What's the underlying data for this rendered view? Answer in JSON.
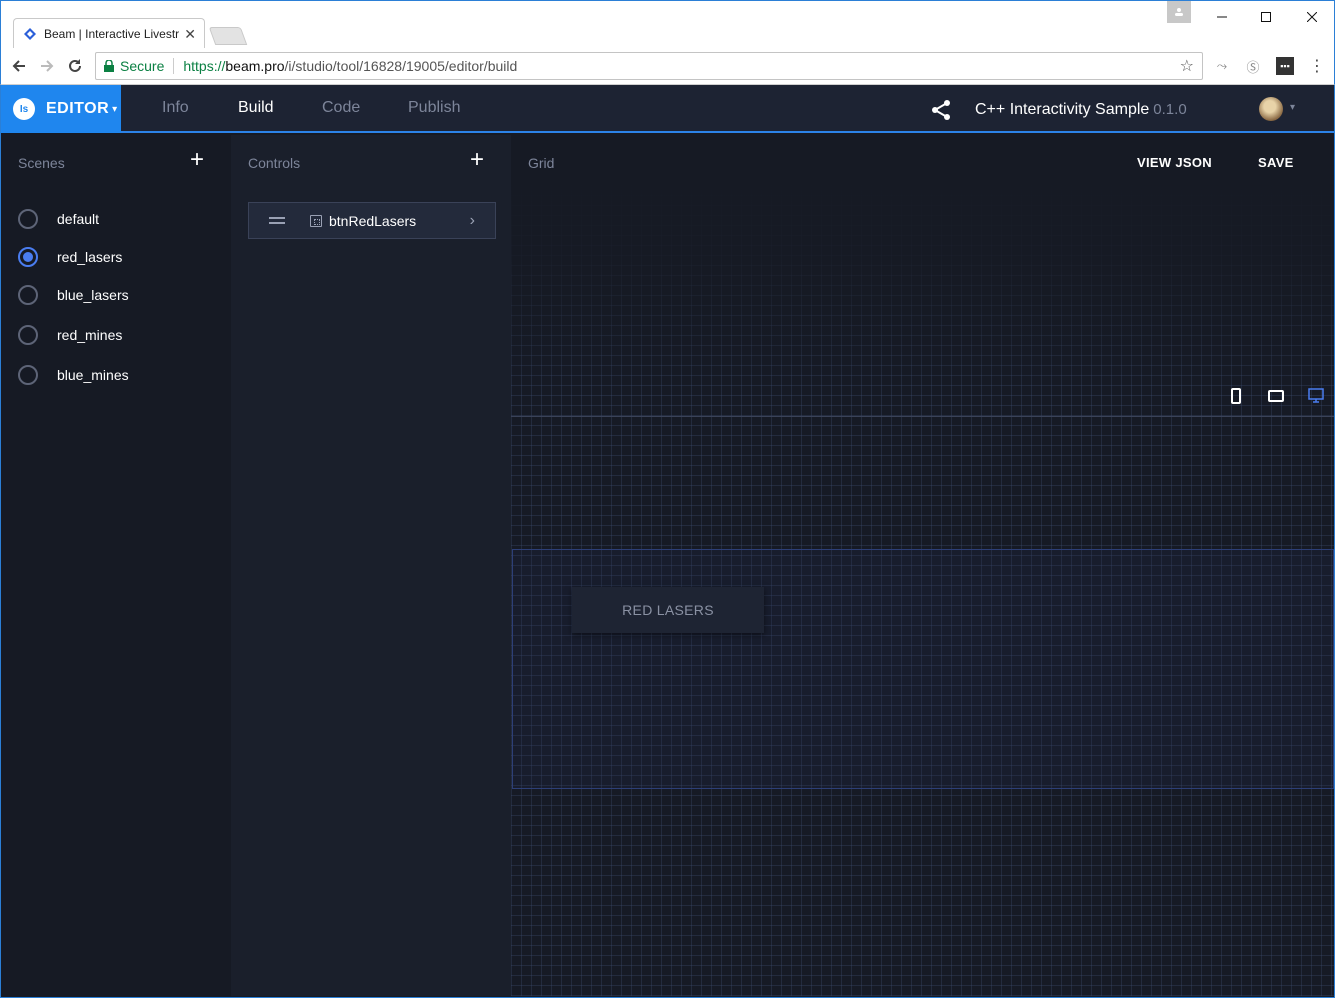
{
  "browser": {
    "tab_title": "Beam | Interactive Livestr",
    "tab_close": "✕",
    "secure_label": "Secure",
    "url_prefix": "https://",
    "url_host": "beam.pro",
    "url_path": "/i/studio/tool/16828/19005/editor/build"
  },
  "appbar": {
    "logo_text": "Is",
    "editor_label": "EDITOR",
    "editor_caret": "▾",
    "menu": [
      {
        "label": "Info"
      },
      {
        "label": "Build"
      },
      {
        "label": "Code"
      },
      {
        "label": "Publish"
      }
    ],
    "active_menu": "Build",
    "project_name": "C++ Interactivity Sample",
    "project_version": "0.1.0",
    "avatar_caret": "▾"
  },
  "scenes": {
    "header": "Scenes",
    "add_label": "+",
    "items": [
      {
        "label": "default",
        "selected": false
      },
      {
        "label": "red_lasers",
        "selected": true
      },
      {
        "label": "blue_lasers",
        "selected": false
      },
      {
        "label": "red_mines",
        "selected": false
      },
      {
        "label": "blue_mines",
        "selected": false
      }
    ]
  },
  "controls": {
    "header": "Controls",
    "add_label": "+",
    "items": [
      {
        "label": "btnRedLasers",
        "chevron": "›"
      }
    ]
  },
  "grid": {
    "header": "Grid",
    "view_json_label": "VIEW JSON",
    "save_label": "SAVE",
    "devices": [
      "phone-icon",
      "tablet-icon",
      "desktop-icon"
    ],
    "active_device": "desktop-icon",
    "button_label": "RED LASERS"
  },
  "colors": {
    "accent": "#1f86ee",
    "radio_selected": "#4a7df0",
    "app_background": "#161a24"
  }
}
